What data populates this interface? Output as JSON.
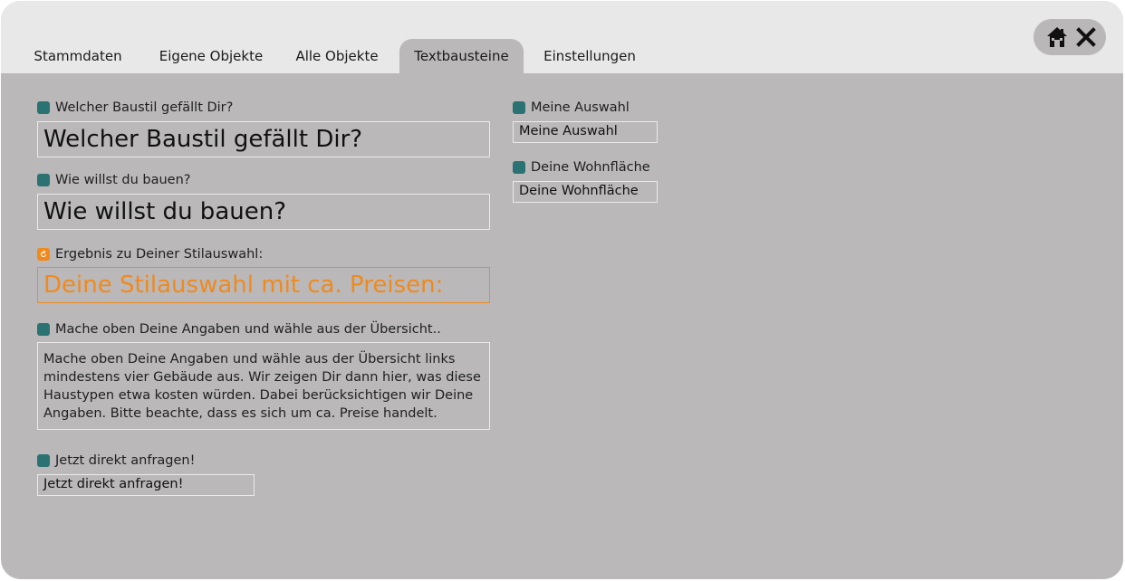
{
  "tabs": [
    {
      "label": "Stammdaten"
    },
    {
      "label": "Eigene Objekte"
    },
    {
      "label": "Alle Objekte"
    },
    {
      "label": "Textbausteine"
    },
    {
      "label": "Einstellungen"
    }
  ],
  "active_tab": "Textbausteine",
  "controls": {
    "home_icon": "home-icon",
    "close_icon": "close-icon"
  },
  "colors": {
    "accent_teal": "#2b7272",
    "accent_orange": "#f08a1d",
    "panel_bg": "#bab8b9"
  },
  "left": {
    "q1": {
      "label": "Welcher Baustil gefällt Dir?",
      "value": "Welcher Baustil gefällt Dir?"
    },
    "q2": {
      "label": "Wie willst du bauen?",
      "value": "Wie willst du bauen?"
    },
    "result": {
      "label": "Ergebnis zu Deiner Stilauswahl:",
      "value": "Deine Stilauswahl mit ca. Preisen:"
    },
    "hint": {
      "label": "Mache oben Deine Angaben und wähle aus der Übersicht..",
      "value": "Mache oben Deine Angaben und wähle aus der Übersicht links mindestens vier Gebäude aus. Wir zeigen Dir dann hier, was diese Haustypen etwa kosten würden. Dabei berücksichtigen wir Deine Angaben. Bitte beachte, dass es sich um ca. Preise handelt."
    },
    "cta": {
      "label": "Jetzt direkt anfragen!",
      "value": "Jetzt direkt anfragen!"
    }
  },
  "right": {
    "selection": {
      "label": "Meine Auswahl",
      "value": "Meine Auswahl"
    },
    "area": {
      "label": "Deine Wohnfläche",
      "value": "Deine Wohnfläche"
    }
  }
}
